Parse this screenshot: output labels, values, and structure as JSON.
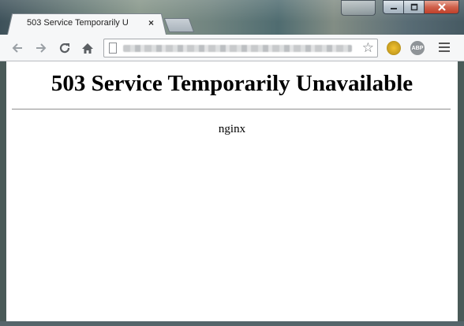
{
  "window": {
    "controls": [
      "minimize",
      "maximize",
      "close"
    ]
  },
  "tab": {
    "title": "503 Service Temporarily U",
    "close_glyph": "×"
  },
  "toolbar": {
    "back_icon": "back-arrow-icon",
    "forward_icon": "forward-arrow-icon",
    "reload_icon": "reload-icon",
    "home_icon": "home-icon",
    "bookmark_icon": "star-icon",
    "extension_label": "ABP",
    "menu_icon": "hamburger-menu-icon"
  },
  "page": {
    "heading": "503 Service Temporarily Unavailable",
    "server": "nginx"
  },
  "colors": {
    "close_button": "#c9503a",
    "toolbar_bg": "#f6f7f8"
  }
}
